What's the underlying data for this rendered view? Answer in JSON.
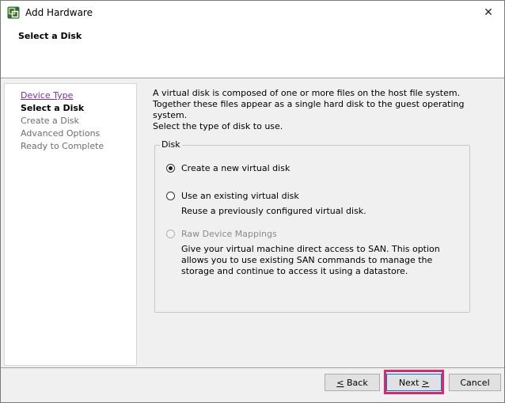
{
  "window": {
    "title": "Add Hardware",
    "close_glyph": "✕",
    "icon": "vsphere-icon"
  },
  "header": {
    "title": "Select a Disk"
  },
  "nav": {
    "items": [
      {
        "label": "Device Type",
        "state": "link"
      },
      {
        "label": "Select a Disk",
        "state": "current"
      },
      {
        "label": "Create a Disk",
        "state": "disabled"
      },
      {
        "label": "Advanced Options",
        "state": "disabled"
      },
      {
        "label": "Ready to Complete",
        "state": "disabled"
      }
    ]
  },
  "main": {
    "description": "A virtual disk is composed of one or more files on the host file system. Together these files appear as a single hard disk to the guest operating system.",
    "select_label": "Select the type of disk to use.",
    "group_label": "Disk",
    "options": [
      {
        "label": "Create a new virtual disk",
        "selected": true,
        "enabled": true,
        "sub": ""
      },
      {
        "label": "Use an existing virtual disk",
        "selected": false,
        "enabled": true,
        "sub": "Reuse a previously configured virtual disk."
      },
      {
        "label": "Raw Device Mappings",
        "selected": false,
        "enabled": false,
        "sub": "Give your virtual machine direct access to SAN. This option allows you to use existing SAN commands to manage the storage and continue to access it using a datastore."
      }
    ]
  },
  "footer": {
    "back": {
      "accel": "<",
      "rest": " Back"
    },
    "next": {
      "label": "Next ",
      "accel": ">"
    },
    "cancel": "Cancel"
  },
  "colors": {
    "highlight": "#e0266b",
    "link": "#7a2fa8"
  }
}
